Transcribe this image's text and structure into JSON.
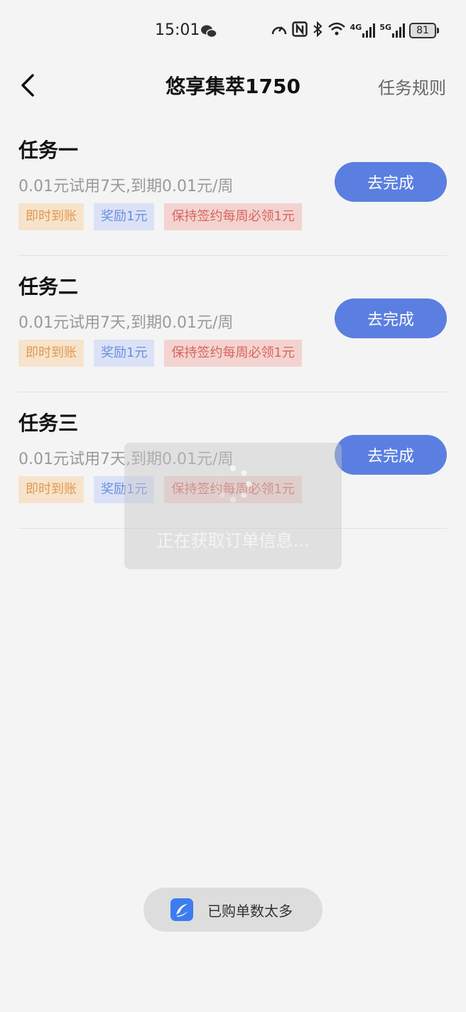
{
  "status_bar": {
    "time": "15:01",
    "net1": "4G",
    "net2": "5G",
    "battery": "81"
  },
  "nav": {
    "title": "悠享集萃1750",
    "rules_label": "任务规则"
  },
  "tasks": [
    {
      "title": "任务一",
      "desc": "0.01元试用7天,到期0.01元/周",
      "tags": [
        "即时到账",
        "奖励1元",
        "保持签约每周必领1元"
      ],
      "button": "去完成"
    },
    {
      "title": "任务二",
      "desc": "0.01元试用7天,到期0.01元/周",
      "tags": [
        "即时到账",
        "奖励1元",
        "保持签约每周必领1元"
      ],
      "button": "去完成"
    },
    {
      "title": "任务三",
      "desc": "0.01元试用7天,到期0.01元/周",
      "tags": [
        "即时到账",
        "奖励1元",
        "保持签约每周必领1元"
      ],
      "button": "去完成"
    }
  ],
  "loading": {
    "text": "正在获取订单信息..."
  },
  "toast": {
    "text": "已购单数太多"
  },
  "colors": {
    "accent": "#5b7fe0",
    "tag_orange": "#e19a4e",
    "tag_blue": "#6c8de0",
    "tag_red": "#d8645d"
  }
}
